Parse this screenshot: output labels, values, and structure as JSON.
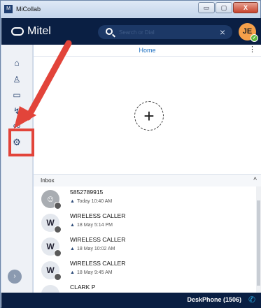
{
  "window": {
    "title": "MiCollab",
    "app_icon": "micollab-icon",
    "buttons": [
      "minimize-icon",
      "maximize-icon",
      "close-icon"
    ],
    "minimize_glyph": "▭",
    "maximize_glyph": "▢",
    "close_glyph": "X"
  },
  "header": {
    "logo_text": "Mitel",
    "search_placeholder": "Search or Dial",
    "clear_glyph": "×",
    "user_initials": "JE",
    "presence_glyph": "✓",
    "colors": {
      "header_bg": "#0a1f43",
      "avatar": "#f5a04a",
      "presence": "#5fb83c"
    }
  },
  "sidebar": {
    "items": [
      {
        "icon": "home-icon",
        "glyph": "⌂"
      },
      {
        "icon": "user-icon",
        "glyph": "♙"
      },
      {
        "icon": "chat-icon",
        "glyph": "▭"
      },
      {
        "icon": "calls-icon",
        "glyph": "↯"
      },
      {
        "icon": "voicemail-icon",
        "glyph": "oo"
      },
      {
        "icon": "gear-icon",
        "glyph": "⚙"
      }
    ],
    "expand_glyph": "›"
  },
  "main": {
    "home_label": "Home",
    "menu_glyph": "⋮",
    "add_glyph": "+"
  },
  "inbox": {
    "label": "Inbox",
    "collapse_glyph": "^",
    "items": [
      {
        "type": "contact",
        "avatar": "",
        "name": "5852789915",
        "meta": "Today 10:40 AM"
      },
      {
        "type": "caller",
        "avatar": "W",
        "name": "WIRELESS CALLER",
        "meta": "18 May 5:14 PM"
      },
      {
        "type": "caller",
        "avatar": "W",
        "name": "WIRELESS CALLER",
        "meta": "18 May 10:02 AM"
      },
      {
        "type": "caller",
        "avatar": "W",
        "name": "WIRELESS CALLER",
        "meta": "18 May 9:45 AM"
      },
      {
        "type": "caller",
        "avatar": "",
        "name": "CLARK P",
        "meta": ""
      }
    ]
  },
  "status_bar": {
    "deskphone": "DeskPhone (1506)",
    "phone_glyph": "✆"
  },
  "annotation": {
    "color": "#e2443a"
  }
}
